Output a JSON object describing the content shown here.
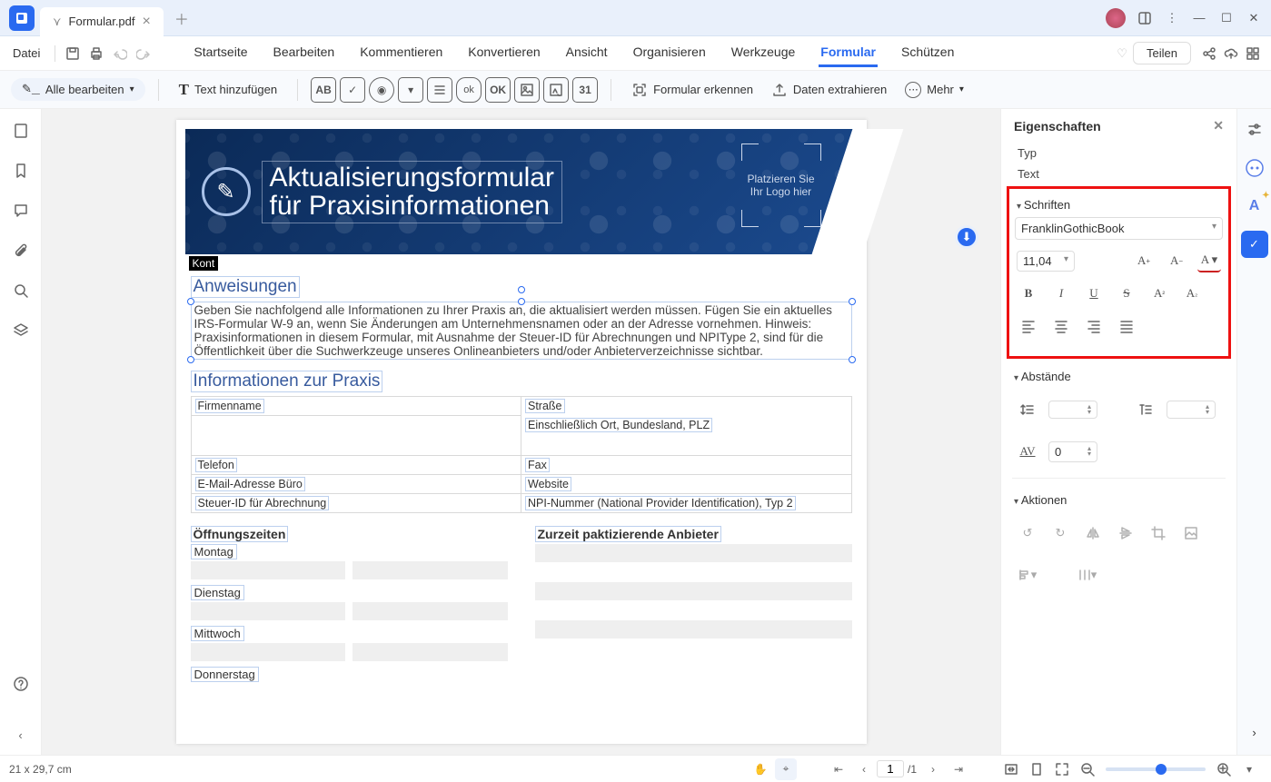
{
  "titlebar": {
    "filename": "Formular.pdf"
  },
  "menubar": {
    "file": "Datei",
    "items": [
      "Startseite",
      "Bearbeiten",
      "Kommentieren",
      "Konvertieren",
      "Ansicht",
      "Organisieren",
      "Werkzeuge",
      "Formular",
      "Schützen"
    ],
    "active_index": 7,
    "share": "Teilen"
  },
  "toolbar": {
    "edit_all": "Alle bearbeiten",
    "add_text": "Text hinzufügen",
    "icons": [
      "AB",
      "check",
      "radio",
      "check2",
      "list",
      "ok-round",
      "OK",
      "image",
      "img-down",
      "31"
    ],
    "recognize": "Formular erkennen",
    "extract": "Daten extrahieren",
    "more": "Mehr"
  },
  "document": {
    "kont": "Kont",
    "header_title_l1": "Aktualisierungsformular",
    "header_title_l2": "für Praxisinformationen",
    "logo_placeholder": "Platzieren Sie Ihr Logo hier",
    "h_anweisungen": "Anweisungen",
    "para_anweisungen": "Geben Sie nachfolgend alle Informationen zu Ihrer Praxis an, die aktualisiert werden müssen. Fügen Sie ein aktuelles IRS-Formular W-9 an, wenn Sie Änderungen am Unternehmensnamen oder an der Adresse vornehmen. Hinweis: Praxisinformationen in diesem Formular, mit Ausnahme der Steuer-ID für Abrechnungen und NPIType 2, sind für die Öffentlichkeit über die Suchwerkzeuge unseres Onlineanbieters und/oder Anbieterverzeichnisse sichtbar.",
    "h_info": "Informationen zur Praxis",
    "tbl": {
      "firmenname": "Firmenname",
      "strasse": "Straße",
      "strasse2": "Einschließlich Ort, Bundesland, PLZ",
      "telefon": "Telefon",
      "fax": "Fax",
      "email": "E-Mail-Adresse Büro",
      "website": "Website",
      "steuer": "Steuer-ID für Abrechnung",
      "npi": "NPI-Nummer (National Provider Identification), Typ 2"
    },
    "h_hours": "Öffnungszeiten",
    "h_providers": "Zurzeit paktizierende Anbieter",
    "days": [
      "Montag",
      "Dienstag",
      "Mittwoch",
      "Donnerstag"
    ]
  },
  "properties": {
    "title": "Eigenschaften",
    "typ_label": "Typ",
    "text_label": "Text",
    "fonts_section": "Schriften",
    "font_name": "FranklinGothicBook",
    "font_size": "11,04",
    "spacing_section": "Abstände",
    "spacing_value": "0",
    "actions_section": "Aktionen"
  },
  "statusbar": {
    "dimensions": "21 x 29,7 cm",
    "page_current": "1",
    "page_total": "/1",
    "zoom_percent": 50
  }
}
